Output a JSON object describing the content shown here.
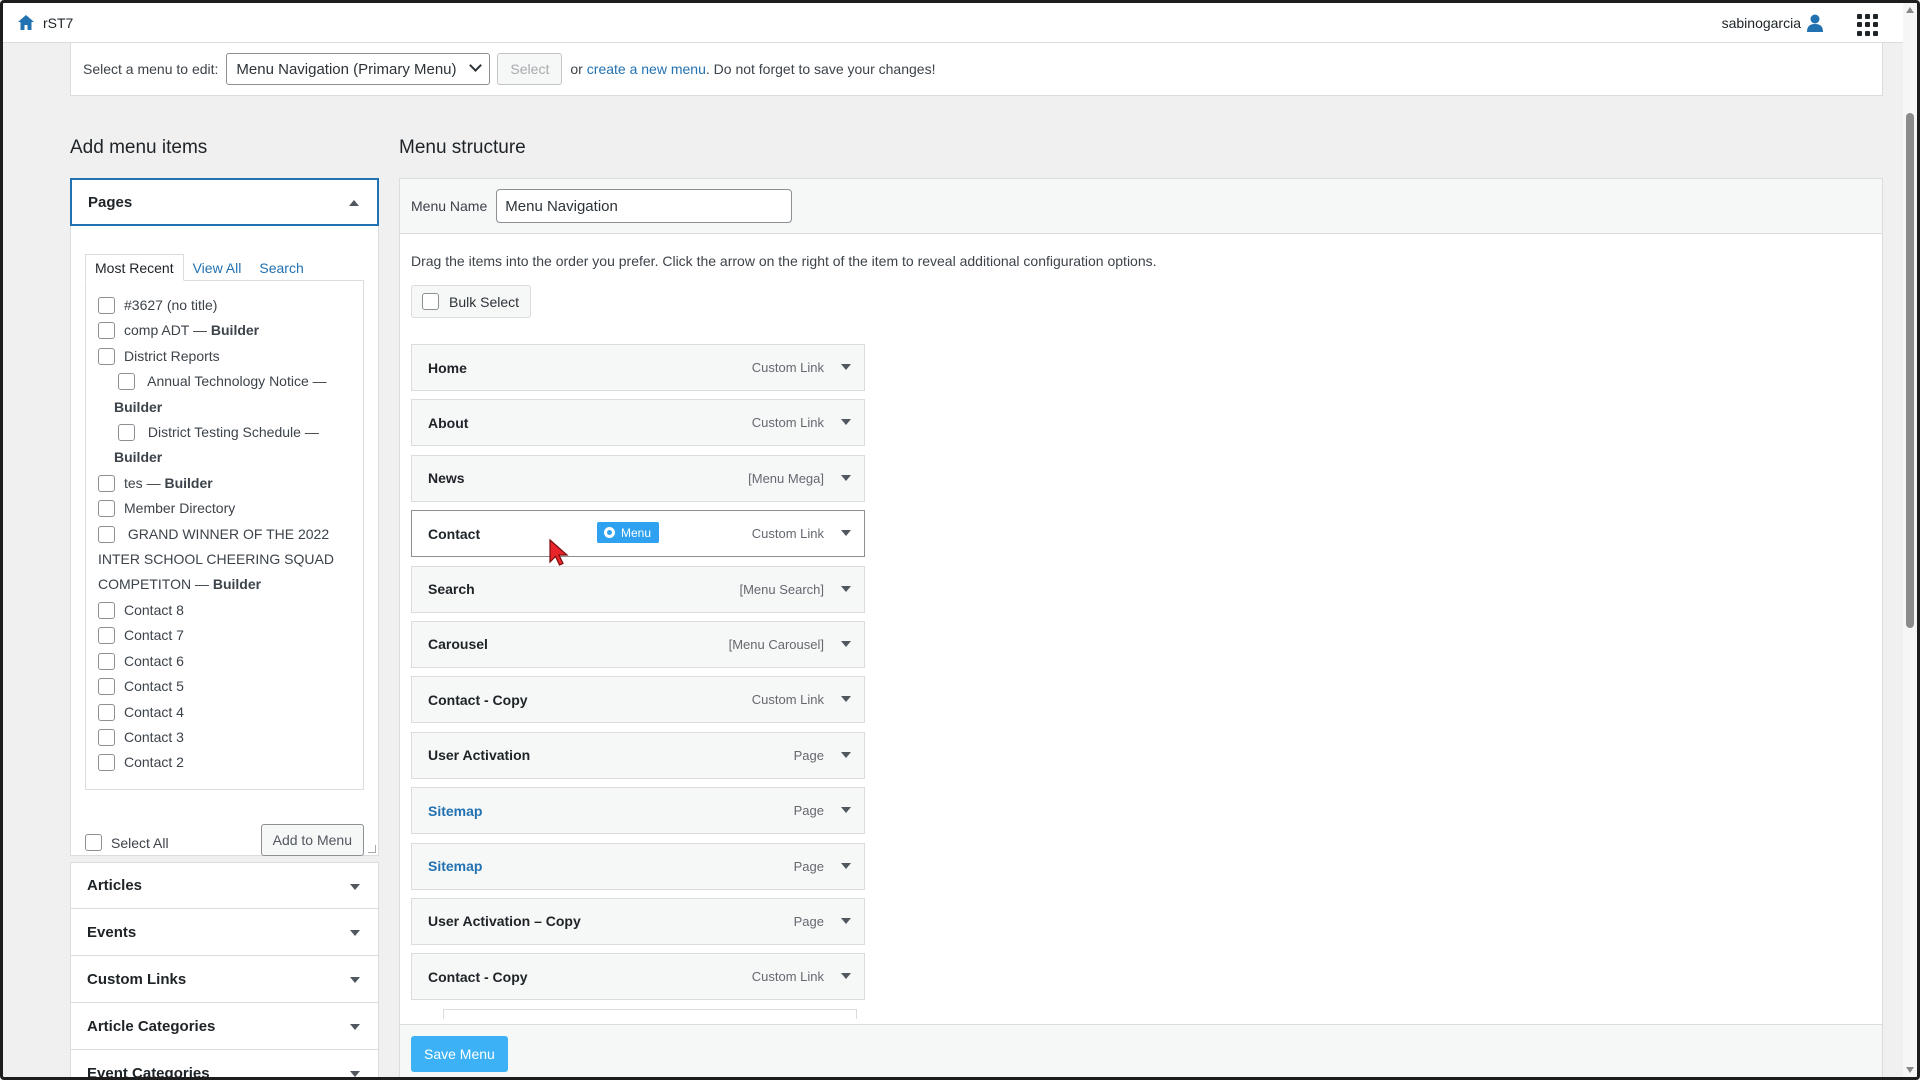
{
  "topbar": {
    "site_name": "rST7",
    "username": "sabinogarcia"
  },
  "menu_select": {
    "label": "Select a menu to edit:",
    "selected": "Menu Navigation (Primary Menu)",
    "select_button": "Select",
    "or_text": "or",
    "create_link": "create a new menu",
    "tail_text": ". Do not forget to save your changes!"
  },
  "add_items": {
    "heading": "Add menu items",
    "pages": {
      "title": "Pages",
      "tabs": [
        "Most Recent",
        "View All",
        "Search"
      ],
      "items": [
        {
          "text": "#3627 (no title)",
          "suffix": ""
        },
        {
          "text": "comp ADT",
          "suffix": "Builder"
        },
        {
          "text": "District Reports",
          "suffix": ""
        },
        {
          "text": "Annual Technology Notice —",
          "suffix": "Builder"
        },
        {
          "text": "District Testing Schedule —",
          "suffix": "Builder"
        },
        {
          "text": "tes",
          "suffix": "Builder"
        },
        {
          "text": "Member Directory",
          "suffix": ""
        },
        {
          "text": "GRAND WINNER OF THE 2022",
          "cont": "INTER SCHOOL CHEERING SQUAD",
          "cont2": "COMPETITON",
          "suffix": "Builder"
        },
        {
          "text": "Contact 8",
          "suffix": ""
        },
        {
          "text": "Contact 7",
          "suffix": ""
        },
        {
          "text": "Contact 6",
          "suffix": ""
        },
        {
          "text": "Contact 5",
          "suffix": ""
        },
        {
          "text": "Contact 4",
          "suffix": ""
        },
        {
          "text": "Contact 3",
          "suffix": ""
        },
        {
          "text": "Contact 2",
          "suffix": ""
        }
      ],
      "em_dash": "—",
      "select_all": "Select All",
      "add_button": "Add to Menu"
    },
    "sections": [
      "Articles",
      "Events",
      "Custom Links",
      "Article Categories",
      "Event Categories"
    ]
  },
  "structure": {
    "heading": "Menu structure",
    "menu_name_label": "Menu Name",
    "menu_name_value": "Menu Navigation",
    "description": "Drag the items into the order you prefer. Click the arrow on the right of the item to reveal additional configuration options.",
    "bulk_select": "Bulk Select",
    "items": [
      {
        "title": "Home",
        "type": "Custom Link"
      },
      {
        "title": "About",
        "type": "Custom Link"
      },
      {
        "title": "News",
        "type": "[Menu Mega]"
      },
      {
        "title": "Contact",
        "type": "Custom Link",
        "badge": "Menu"
      },
      {
        "title": "Search",
        "type": "[Menu Search]"
      },
      {
        "title": "Carousel",
        "type": "[Menu Carousel]"
      },
      {
        "title": "Contact - Copy",
        "type": "Custom Link"
      },
      {
        "title": "User Activation",
        "type": "Page"
      },
      {
        "title": "Sitemap",
        "type": "Page"
      },
      {
        "title": "Sitemap",
        "type": "Page"
      },
      {
        "title": "User Activation – Copy",
        "type": "Page"
      },
      {
        "title": "Contact - Copy",
        "type": "Custom Link"
      }
    ],
    "save_button": "Save Menu"
  },
  "colors": {
    "accent": "#2271b1",
    "save_button": "#3db1f5",
    "badge": "#2ea2f0"
  }
}
